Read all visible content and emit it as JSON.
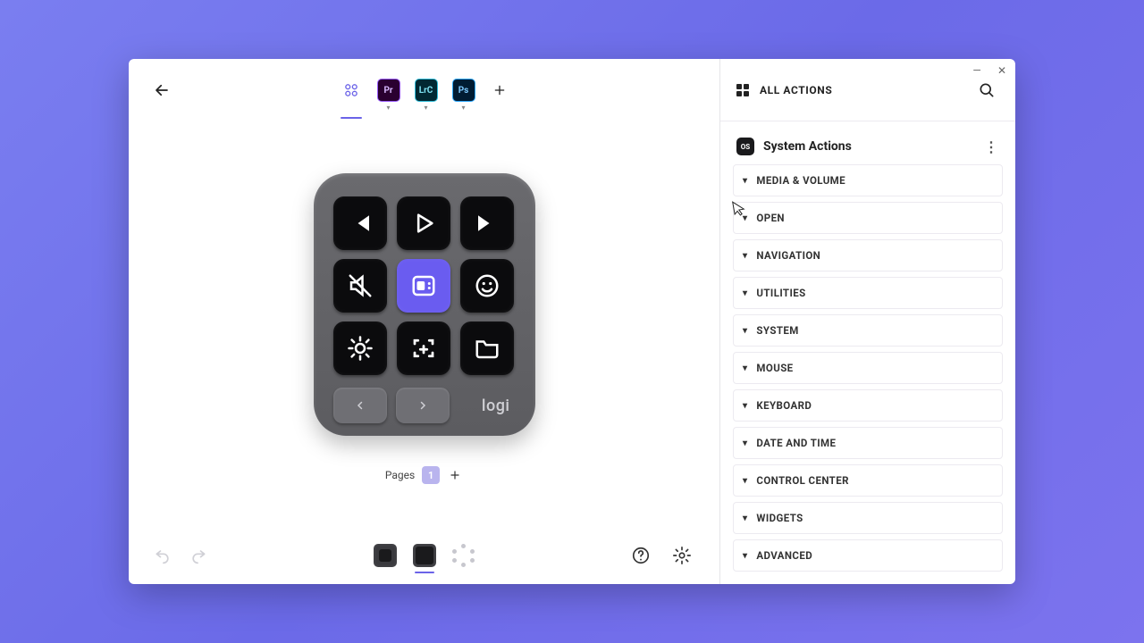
{
  "window": {
    "minimize": "—",
    "close": "✕"
  },
  "tabs": {
    "apps": [
      {
        "code": "Pr",
        "cls": "pr"
      },
      {
        "code": "LrC",
        "cls": "lrc"
      },
      {
        "code": "Ps",
        "cls": "ps"
      }
    ]
  },
  "device": {
    "brand": "logi",
    "pages_label": "Pages",
    "page_current": "1"
  },
  "right": {
    "all_actions": "ALL ACTIONS",
    "section_badge": "OS",
    "section_title": "System Actions",
    "categories": [
      "MEDIA & VOLUME",
      "OPEN",
      "NAVIGATION",
      "UTILITIES",
      "SYSTEM",
      "MOUSE",
      "KEYBOARD",
      "DATE AND TIME",
      "CONTROL CENTER",
      "WIDGETS",
      "ADVANCED"
    ]
  }
}
